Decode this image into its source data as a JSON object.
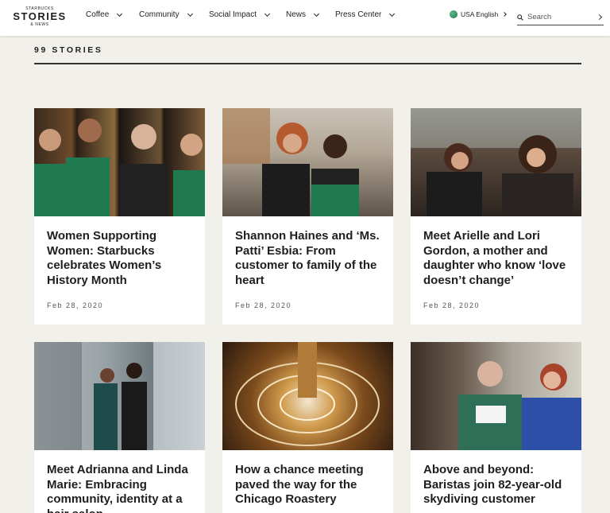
{
  "header": {
    "logo": {
      "line1": "STARBUCKS",
      "line2": "STORIES",
      "line3": "& NEWS"
    },
    "nav": [
      {
        "label": "Coffee"
      },
      {
        "label": "Community"
      },
      {
        "label": "Social Impact"
      },
      {
        "label": "News"
      },
      {
        "label": "Press Center"
      }
    ],
    "language": "USA English",
    "search": {
      "placeholder": "Search",
      "value": ""
    }
  },
  "main": {
    "stories_count_label": "99 STORIES",
    "cards": [
      {
        "title": "Women Supporting Women: Starbucks celebrates Women’s History Month",
        "date": "Feb 28, 2020"
      },
      {
        "title": "Shannon Haines and ‘Ms. Patti’ Esbia: From customer to family of the heart",
        "date": "Feb 28, 2020"
      },
      {
        "title": "Meet Arielle and Lori Gordon, a mother and daughter who know ‘love doesn’t change’",
        "date": "Feb 28, 2020"
      },
      {
        "title": "Meet Adrianna and Linda Marie: Embracing community, identity at a hair salon",
        "date": ""
      },
      {
        "title": "How a chance meeting paved the way for the Chicago Roastery",
        "date": ""
      },
      {
        "title": "Above and beyond: Baristas join 82-year-old skydiving customer",
        "date": ""
      }
    ]
  },
  "colors": {
    "background": "#f2f0eb",
    "card": "#ffffff",
    "text": "#1e1e1e",
    "apron_green": "#1f7a52"
  }
}
